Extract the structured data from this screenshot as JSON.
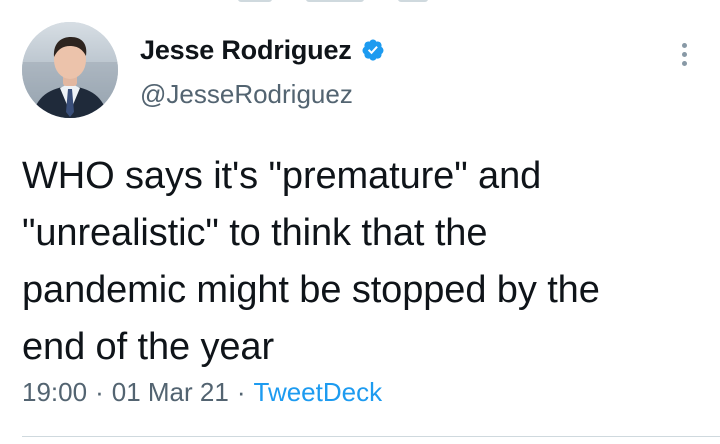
{
  "author": {
    "display_name": "Jesse Rodriguez",
    "handle": "@JesseRodriguez",
    "verified": true,
    "verified_color": "#1d9bf0"
  },
  "tweet": {
    "text": "WHO says it's \"premature\" and\n\"unrealistic\" to think that the\npandemic might be stopped by the\nend of the year"
  },
  "meta": {
    "time": "19:00",
    "separator": "·",
    "date": "01 Mar 21",
    "source": "TweetDeck",
    "source_color": "#1d9bf0"
  },
  "icons": {
    "verified": "verified-badge-icon",
    "more": "more-vertical-icon"
  }
}
